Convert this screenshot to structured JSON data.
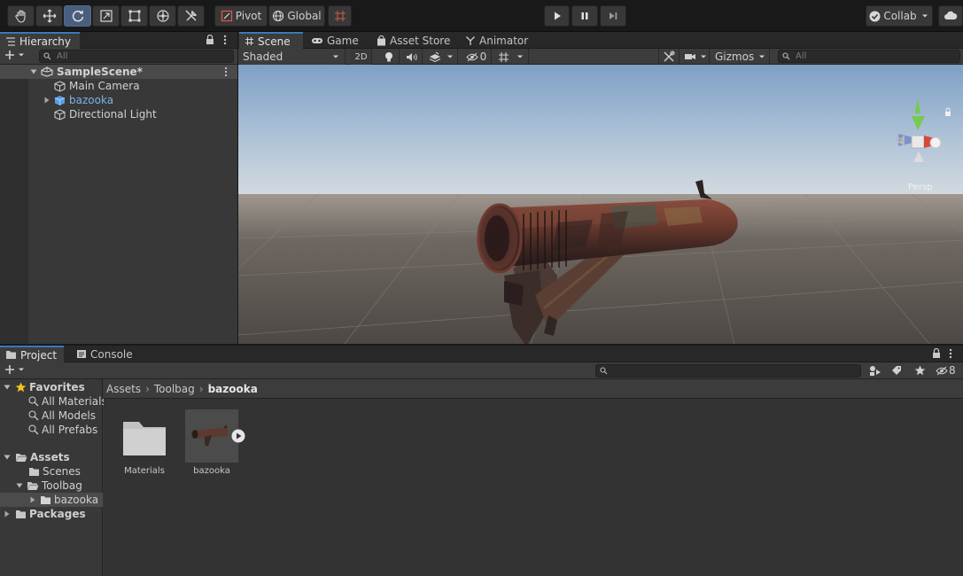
{
  "toolbar": {
    "pivot_label": "Pivot",
    "global_label": "Global",
    "collab_label": "Collab",
    "tools": [
      "hand-tool",
      "move-tool",
      "rotate-tool",
      "scale-tool",
      "rect-tool",
      "transform-tool",
      "custom-tool"
    ],
    "active_tool": "rotate-tool"
  },
  "hierarchy": {
    "tab_label": "Hierarchy",
    "search_placeholder": "All",
    "scene_name": "SampleScene*",
    "items": [
      {
        "label": "Main Camera"
      },
      {
        "label": "bazooka"
      },
      {
        "label": "Directional Light"
      }
    ]
  },
  "scene": {
    "tabs": [
      {
        "label": "Scene"
      },
      {
        "label": "Game"
      },
      {
        "label": "Asset Store"
      },
      {
        "label": "Animator"
      }
    ],
    "shading_mode": "Shaded",
    "mode_2d_label": "2D",
    "hidden_count": "0",
    "gizmos_label": "Gizmos",
    "search_placeholder": "All",
    "gizmo_y": "y",
    "gizmo_z": "z",
    "persp_label": "Persp"
  },
  "project": {
    "tabs": [
      {
        "label": "Project"
      },
      {
        "label": "Console"
      }
    ],
    "hidden_count": "8",
    "favorites_label": "Favorites",
    "favorites": [
      {
        "label": "All Materials"
      },
      {
        "label": "All Models"
      },
      {
        "label": "All Prefabs"
      }
    ],
    "assets_label": "Assets",
    "scenes_label": "Scenes",
    "toolbag_label": "Toolbag",
    "bazooka_folder_label": "bazooka",
    "packages_label": "Packages",
    "breadcrumb": [
      "Assets",
      "Toolbag",
      "bazooka"
    ],
    "assets": [
      {
        "label": "Materials"
      },
      {
        "label": "bazooka"
      }
    ]
  },
  "colors": {
    "accent": "#3a79bb",
    "selection": "#4a4a4a",
    "panel": "#383838",
    "favorite_star": "#f2c418",
    "object_blue": "#7cb2e8"
  }
}
